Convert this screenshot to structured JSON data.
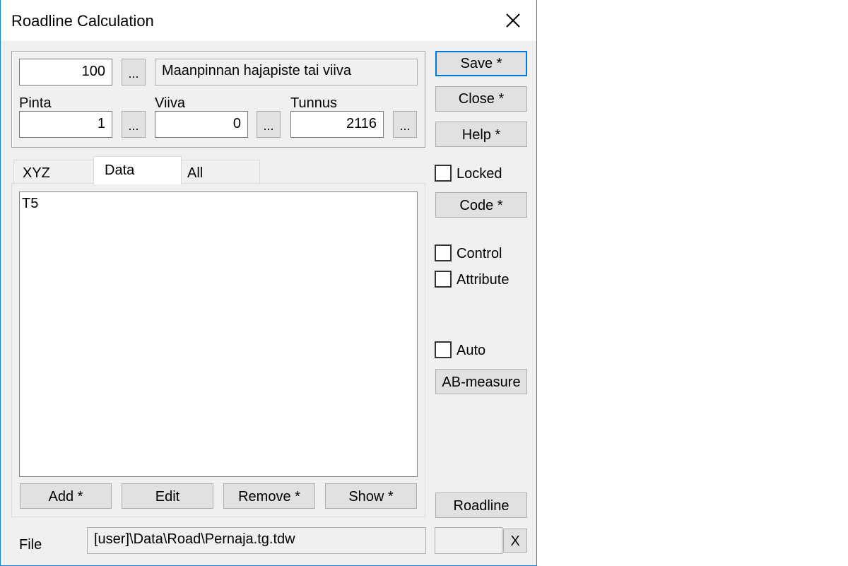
{
  "window": {
    "title": "Roadline Calculation",
    "close_glyph": "✕"
  },
  "top_group": {
    "code_value": "100",
    "code_browse": "...",
    "code_description": "Maanpinnan hajapiste tai viiva",
    "pinta_label": "Pinta",
    "pinta_value": "1",
    "pinta_browse": "...",
    "viiva_label": "Viiva",
    "viiva_value": "0",
    "viiva_browse": "...",
    "tunnus_label": "Tunnus",
    "tunnus_value": "2116",
    "tunnus_browse": "..."
  },
  "tabs": [
    {
      "label": "XYZ",
      "active": false
    },
    {
      "label": "Data",
      "active": true
    },
    {
      "label": "All",
      "active": false
    }
  ],
  "list": {
    "items": [
      "T5"
    ]
  },
  "list_buttons": {
    "add": "Add *",
    "edit": "Edit",
    "remove": "Remove *",
    "show": "Show *"
  },
  "side": {
    "save": "Save *",
    "close": "Close *",
    "help": "Help *",
    "locked": "Locked",
    "code": "Code *",
    "control": "Control",
    "attribute": "Attribute",
    "auto": "Auto",
    "ab_measure": "AB-measure",
    "roadline": "Roadline"
  },
  "file": {
    "label": "File",
    "path": "[user]\\Data\\Road\\Pernaja.tg.tdw",
    "extra_value": "",
    "clear": "X"
  }
}
